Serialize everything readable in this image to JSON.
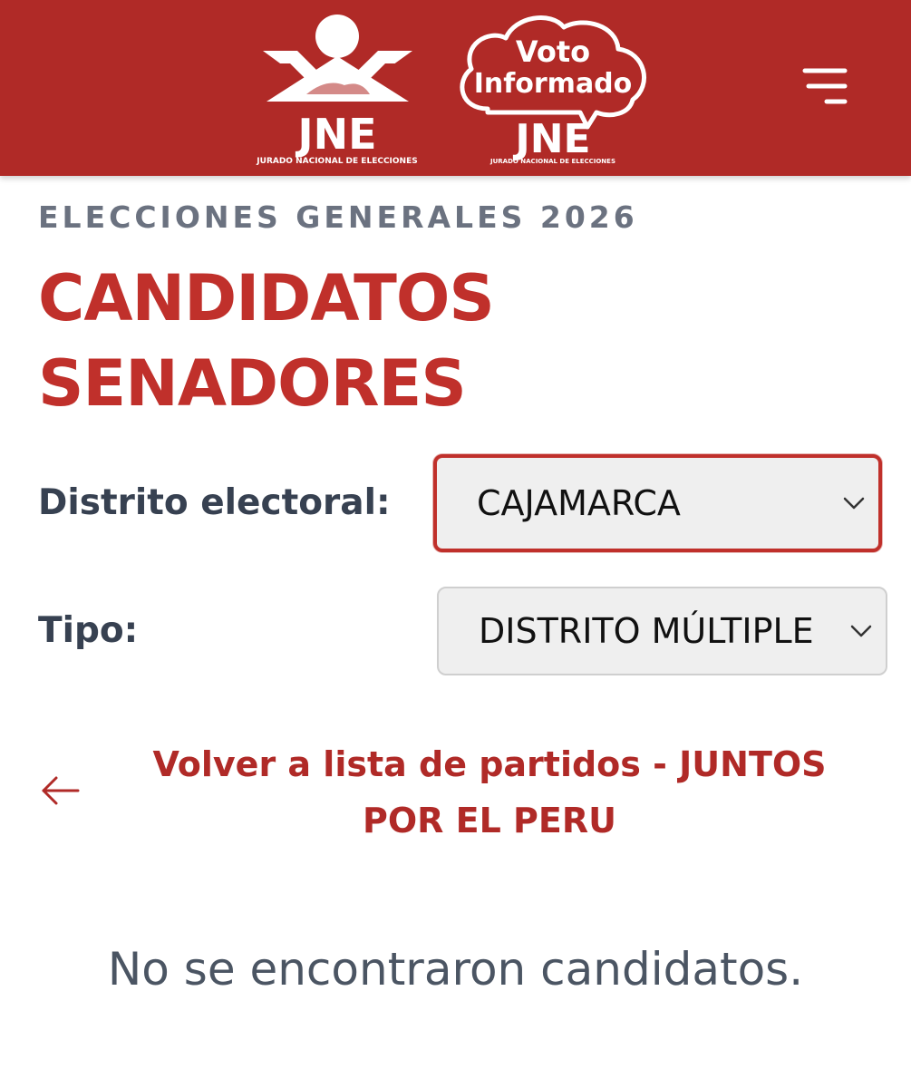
{
  "header": {
    "jne_logo": {
      "text": "JNE",
      "subtext": "JURADO NACIONAL DE ELECCIONES"
    },
    "voto_logo": {
      "line1": "Voto",
      "line2": "Informado",
      "text": "JNE",
      "subtext": "JURADO NACIONAL DE ELECCIONES"
    },
    "menu_icon": "hamburger-menu-icon",
    "background_color": "#b02a27"
  },
  "page": {
    "eyebrow": "ELECCIONES GENERALES 2026",
    "title_line1": "CANDIDATOS",
    "title_line2": "SENADORES",
    "accent_color": "#c0302b"
  },
  "filters": {
    "distrito": {
      "label": "Distrito electoral:",
      "value": "CAJAMARCA"
    },
    "tipo": {
      "label": "Tipo:",
      "value": "DISTRITO MÚLTIPLE"
    }
  },
  "back_link": {
    "icon": "arrow-left-icon",
    "label": "Volver a lista de partidos - JUNTOS POR EL PERU"
  },
  "empty_state": "No se encontraron candidatos."
}
